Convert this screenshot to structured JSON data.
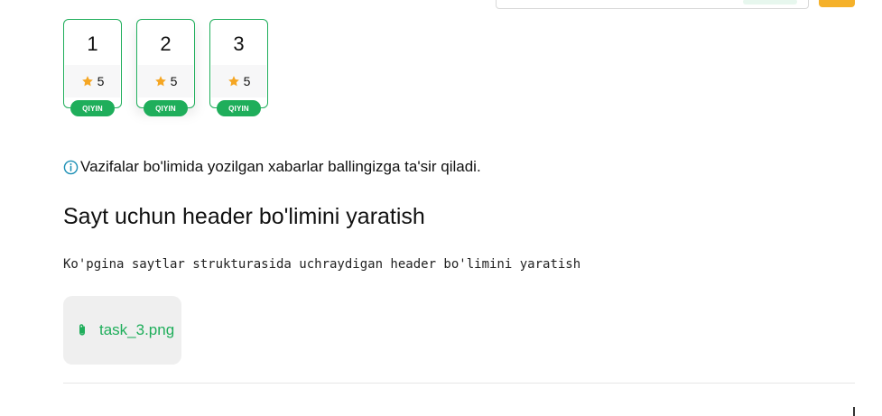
{
  "tasks": [
    {
      "number": "1",
      "score": "5",
      "level": "QIYIN"
    },
    {
      "number": "2",
      "score": "5",
      "level": "QIYIN"
    },
    {
      "number": "3",
      "score": "5",
      "level": "QIYIN"
    }
  ],
  "notice": "Vazifalar bo'limida yozilgan xabarlar ballingizga ta'sir qiladi.",
  "task": {
    "title": "Sayt uchun header bo'limini yaratish",
    "description": "Ko'pgina saytlar strukturasida uchraydigan header bo'limini yaratish",
    "attachment": "task_3.png"
  },
  "icons": {
    "score": "star-icon",
    "notice": "info-icon",
    "attachment": "paperclip-icon"
  },
  "colors": {
    "accent": "#1fae5b",
    "star": "#f5a623",
    "top_button": "#f5b12a",
    "info": "#1c8fb5"
  }
}
